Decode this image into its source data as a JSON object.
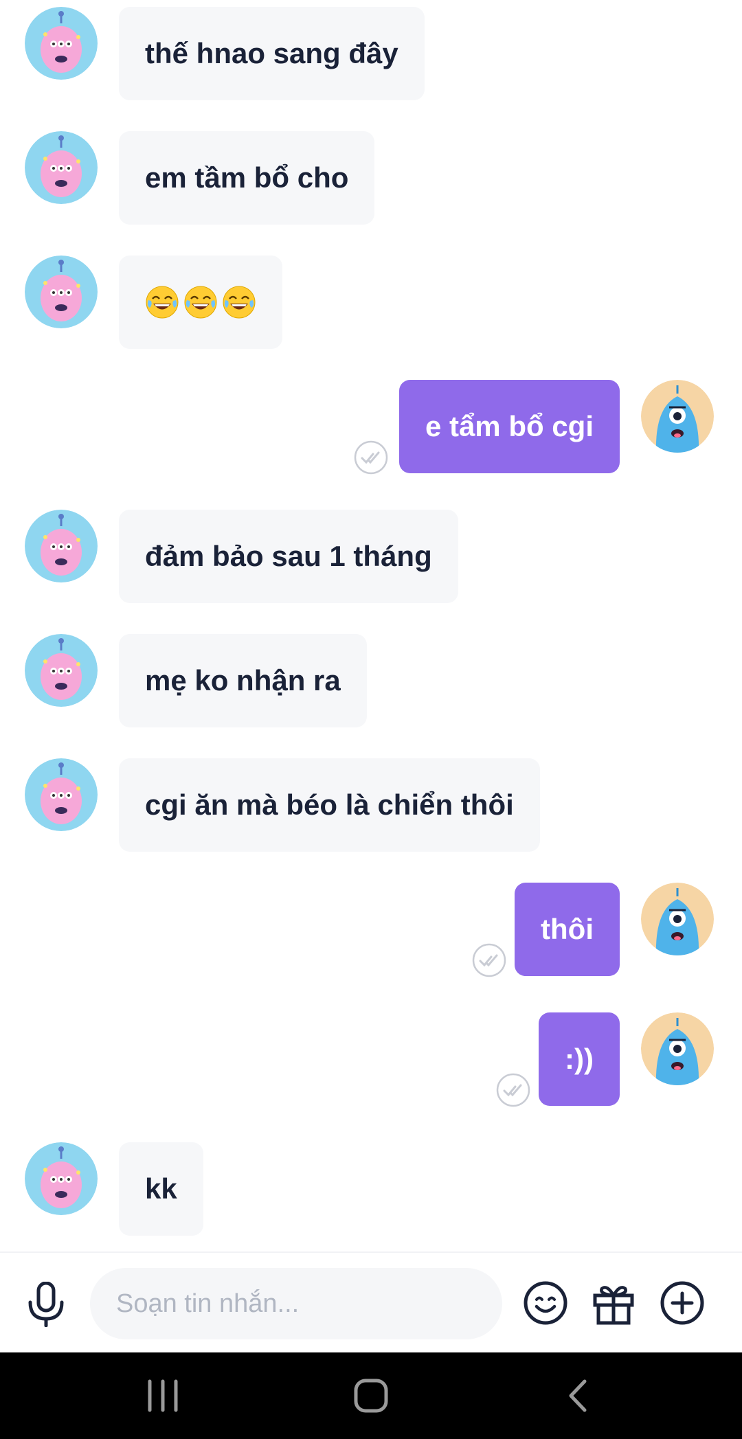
{
  "messages": [
    {
      "sender": "friend",
      "text": "thế hnao sang đây"
    },
    {
      "sender": "friend",
      "text": "em tầm bổ cho"
    },
    {
      "sender": "friend",
      "text": "",
      "emoji": [
        "face-with-tears-of-joy",
        "face-with-tears-of-joy",
        "face-with-tears-of-joy"
      ]
    },
    {
      "sender": "me",
      "text": "e tẩm bổ cgi",
      "status": "read"
    },
    {
      "sender": "friend",
      "text": "đảm bảo sau 1 tháng"
    },
    {
      "sender": "friend",
      "text": "mẹ ko nhận ra"
    },
    {
      "sender": "friend",
      "text": "cgi ăn mà béo là chiển thôi"
    },
    {
      "sender": "me",
      "text": "thôi",
      "status": "read"
    },
    {
      "sender": "me",
      "text": ":))",
      "status": "read"
    },
    {
      "sender": "friend",
      "text": "kk"
    }
  ],
  "composer": {
    "placeholder": "Soạn tin nhắn...",
    "value": "",
    "icons": [
      "microphone-icon",
      "emoji-icon",
      "gift-icon",
      "plus-circle-icon"
    ]
  },
  "system_nav": {
    "icons": [
      "recent-apps-icon",
      "home-icon",
      "back-icon"
    ]
  },
  "colors": {
    "outgoing_bubble": "#8f6aea",
    "incoming_bubble": "#f6f7f9",
    "incoming_text": "#1a2238",
    "outgoing_text": "#ffffff",
    "friend_avatar_bg": "#8fd6f0",
    "my_avatar_bg": "#f6d5a5"
  }
}
